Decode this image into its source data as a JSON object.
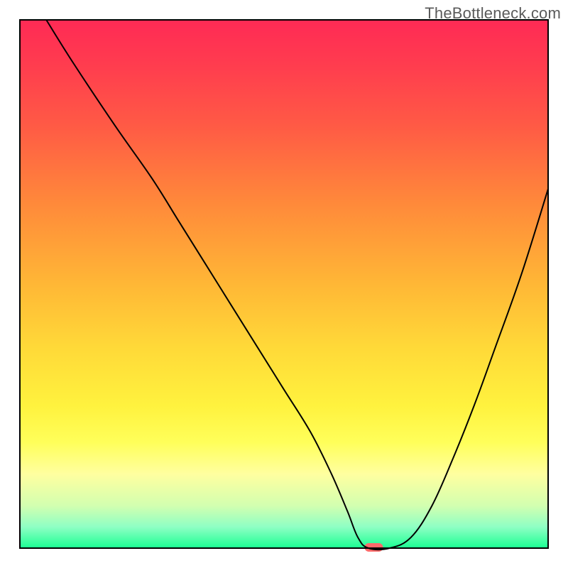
{
  "watermark": "TheBottleneck.com",
  "chart_data": {
    "type": "line",
    "title": "",
    "xlabel": "",
    "ylabel": "",
    "xlim": [
      0,
      100
    ],
    "ylim": [
      0,
      100
    ],
    "grid": false,
    "legend": false,
    "gradient_stops": [
      {
        "offset": 0.0,
        "color": "#ff2a55"
      },
      {
        "offset": 0.08,
        "color": "#ff3b4f"
      },
      {
        "offset": 0.2,
        "color": "#ff5a45"
      },
      {
        "offset": 0.35,
        "color": "#ff8a3a"
      },
      {
        "offset": 0.5,
        "color": "#ffb736"
      },
      {
        "offset": 0.62,
        "color": "#ffd938"
      },
      {
        "offset": 0.73,
        "color": "#fff23e"
      },
      {
        "offset": 0.8,
        "color": "#ffff5a"
      },
      {
        "offset": 0.86,
        "color": "#ffffa0"
      },
      {
        "offset": 0.92,
        "color": "#d2ffb0"
      },
      {
        "offset": 0.96,
        "color": "#8effc4"
      },
      {
        "offset": 1.0,
        "color": "#1bff93"
      }
    ],
    "series": [
      {
        "name": "bottleneck-curve",
        "color": "#000000",
        "x": [
          5,
          10,
          18,
          25,
          30,
          35,
          40,
          45,
          50,
          55,
          59,
          62,
          64,
          66,
          70,
          74,
          78,
          82,
          86,
          90,
          95,
          100
        ],
        "y": [
          100,
          92,
          80,
          70,
          62,
          54,
          46,
          38,
          30,
          22,
          14,
          7,
          2,
          0,
          0,
          2,
          8,
          17,
          27,
          38,
          52,
          68
        ]
      }
    ],
    "marker": {
      "x": 67,
      "y": 0,
      "width": 3.5,
      "height": 1.6,
      "color": "#ff6a6a",
      "name": "optimal-marker"
    },
    "frame": {
      "x": 0,
      "y": 0,
      "w": 100,
      "h": 100,
      "stroke": "#000000",
      "strokeWidth": 2
    }
  }
}
